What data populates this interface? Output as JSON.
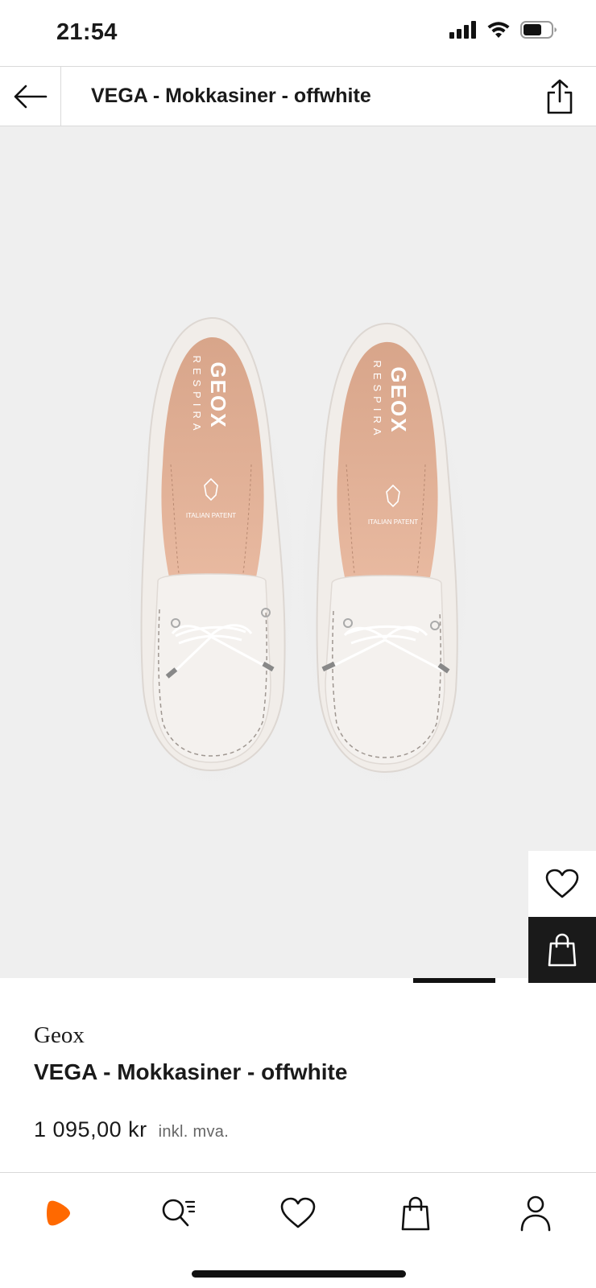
{
  "status_bar": {
    "time": "21:54"
  },
  "header": {
    "title": "VEGA - Mokkasiner - offwhite",
    "back_icon": "arrow-left-icon",
    "share_icon": "share-icon"
  },
  "product_image": {
    "insole_brand": "GEOX",
    "insole_sub": "RESPIRA",
    "insole_patent": "ITALIAN PATENT",
    "actions": {
      "wishlist_icon": "heart-outline-icon",
      "bag_icon": "shopping-bag-icon"
    },
    "carousel": {
      "active_index": 0
    }
  },
  "product": {
    "brand": "Geox",
    "name": "VEGA - Mokkasiner - offwhite",
    "price": "1 095,00 kr",
    "vat_note": "inkl. mva."
  },
  "tab_bar": {
    "items": [
      {
        "icon": "zalando-logo-icon"
      },
      {
        "icon": "search-icon"
      },
      {
        "icon": "heart-icon"
      },
      {
        "icon": "bag-icon"
      },
      {
        "icon": "profile-icon"
      }
    ]
  },
  "colors": {
    "accent": "#ff6900",
    "image_bg": "#efefef",
    "text": "#1a1a1a",
    "dark_button": "#1a1a1a"
  }
}
